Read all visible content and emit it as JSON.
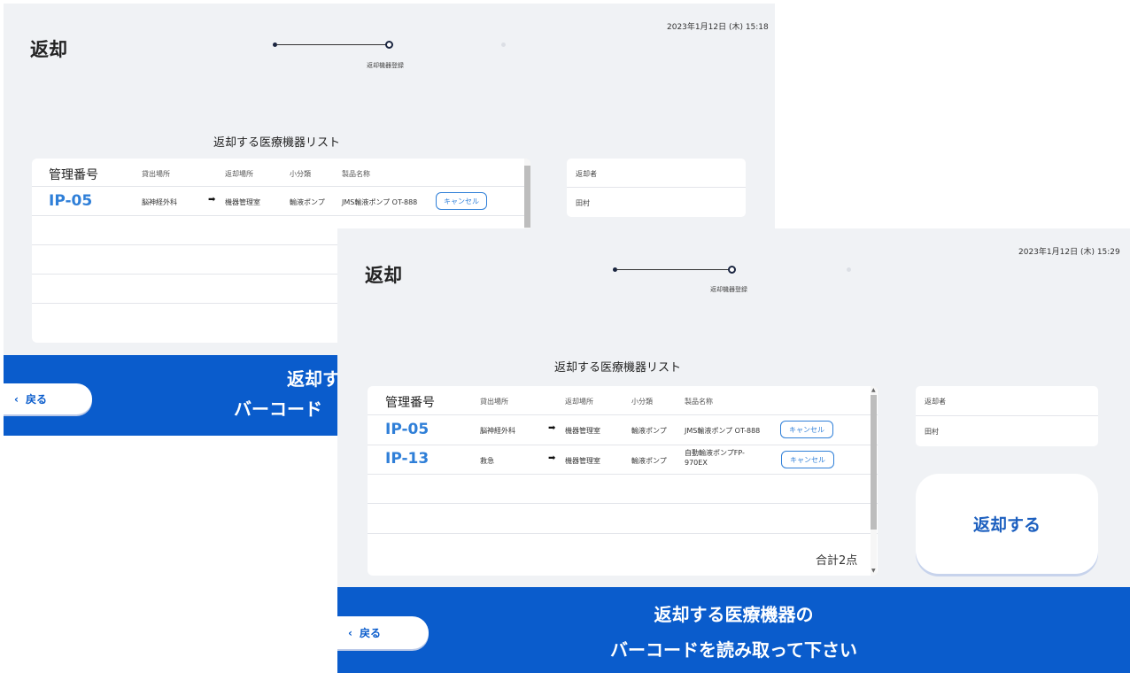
{
  "back_screen": {
    "timestamp": "2023年1月12日 (木) 15:18",
    "title": "返却",
    "step_label": "返却機器登録",
    "list_title": "返却する医療機器リスト",
    "table": {
      "headers": {
        "id": "管理番号",
        "from": "貸出場所",
        "to": "返却場所",
        "category": "小分類",
        "product": "製品名称"
      },
      "rows": [
        {
          "id": "IP-05",
          "from": "脳神経外科",
          "to": "機器管理室",
          "category": "輸液ポンプ",
          "product": "JMS輸液ポンプ OT-888",
          "cancel": "キャンセル"
        }
      ]
    },
    "side": {
      "returner_label": "返却者",
      "returner_name": "田村"
    },
    "banner_line1": "返却す",
    "banner_line2": "バーコード",
    "back_label": "戻る"
  },
  "front_screen": {
    "timestamp": "2023年1月12日 (木) 15:29",
    "title": "返却",
    "step_label": "返却機器登録",
    "list_title": "返却する医療機器リスト",
    "table": {
      "headers": {
        "id": "管理番号",
        "from": "貸出場所",
        "to": "返却場所",
        "category": "小分類",
        "product": "製品名称"
      },
      "rows": [
        {
          "id": "IP-05",
          "from": "脳神経外科",
          "to": "機器管理室",
          "category": "輸液ポンプ",
          "product": "JMS輸液ポンプ OT-888",
          "cancel": "キャンセル"
        },
        {
          "id": "IP-13",
          "from": "救急",
          "to": "機器管理室",
          "category": "輸液ポンプ",
          "product": "自動輸液ポンプFP-970EX",
          "cancel": "キャンセル"
        }
      ],
      "total": "合計2点"
    },
    "side": {
      "returner_label": "返却者",
      "returner_name": "田村"
    },
    "return_button": "返却する",
    "banner_line1": "返却する医療機器の",
    "banner_line2": "バーコードを読み取って下さい",
    "back_label": "戻る"
  },
  "icons": {
    "arrow": "arrow-right-icon",
    "chevron": "chevron-left-icon"
  },
  "colors": {
    "accent_blue": "#0a5ccc",
    "id_blue": "#2f7fd8",
    "background": "#f0f2f5"
  }
}
